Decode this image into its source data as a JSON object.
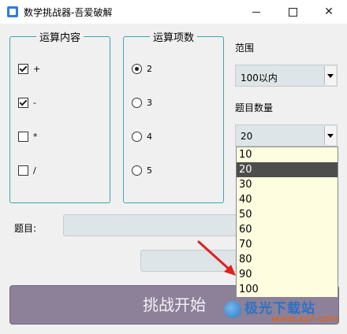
{
  "window": {
    "title": "数学挑战器-吾爱破解"
  },
  "operations": {
    "title": "运算内容",
    "items": [
      {
        "label": "+",
        "checked": true
      },
      {
        "label": "-",
        "checked": true
      },
      {
        "label": "*",
        "checked": false
      },
      {
        "label": "/",
        "checked": false
      }
    ]
  },
  "terms": {
    "title": "运算项数",
    "items": [
      {
        "label": "2",
        "selected": true
      },
      {
        "label": "3",
        "selected": false
      },
      {
        "label": "4",
        "selected": false
      },
      {
        "label": "5",
        "selected": false
      }
    ]
  },
  "range": {
    "label": "范围",
    "value": "100以内"
  },
  "count": {
    "label": "题目数量",
    "value": "20",
    "options": [
      "10",
      "20",
      "30",
      "40",
      "50",
      "60",
      "70",
      "80",
      "90",
      "100"
    ]
  },
  "question": {
    "label": "题目:",
    "value": ""
  },
  "answer": {
    "value": ""
  },
  "start_button": {
    "label": "挑战开始"
  },
  "watermark": {
    "text": "极光下载站",
    "url": "www.xz7.com"
  },
  "colors": {
    "group_border": "#3aa6ad",
    "start_button_bg": "#8d8099",
    "dropdown_bg": "#fffde0",
    "dropdown_selected_bg": "#4d4d4d",
    "annotation_arrow": "#e02020"
  }
}
